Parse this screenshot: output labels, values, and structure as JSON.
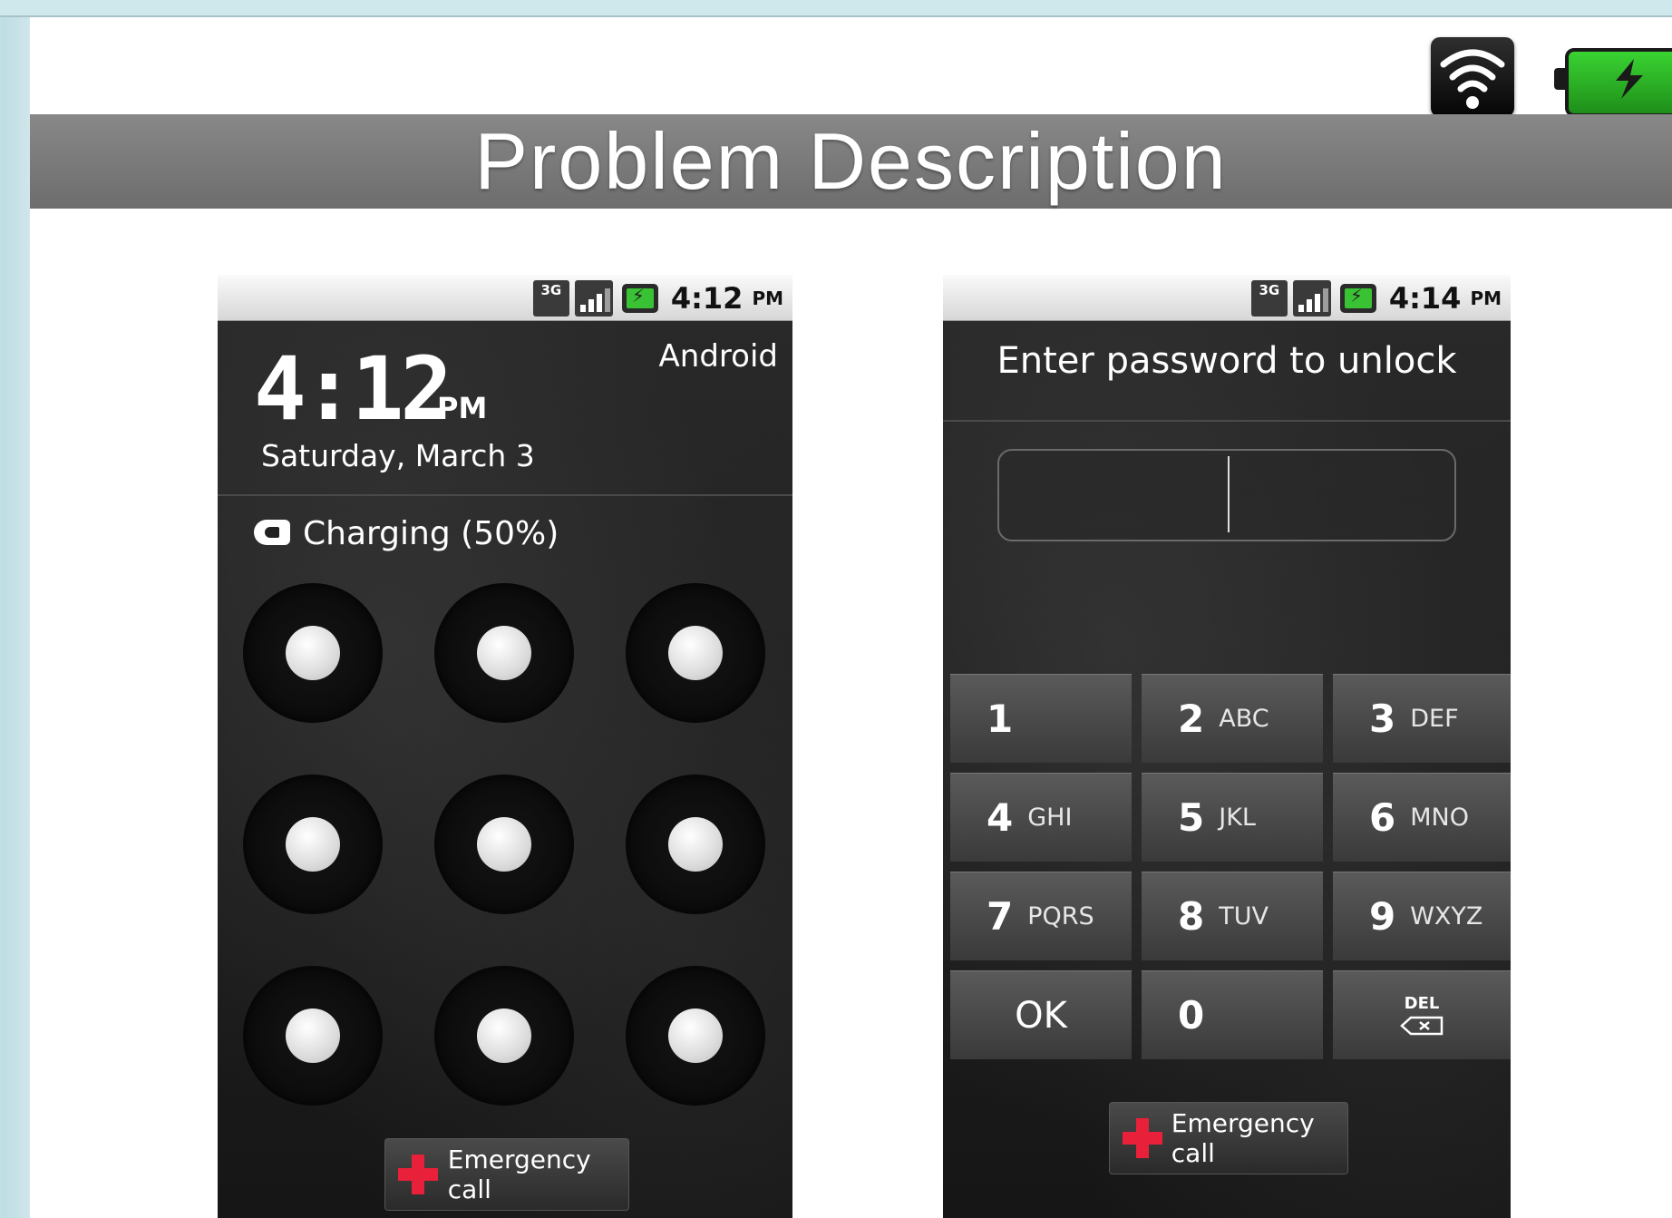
{
  "slide": {
    "title": "Problem Description",
    "icons": [
      "wifi-icon",
      "battery-charging-icon"
    ]
  },
  "lock_pattern_screen": {
    "status_bar": {
      "network": "3G",
      "icons": [
        "3g-icon",
        "signal-icon",
        "battery-icon"
      ],
      "time": "4:12",
      "ampm": "PM"
    },
    "clock": "4:12",
    "clock_ampm": "PM",
    "carrier": "Android",
    "date": "Saturday, March 3",
    "charging": "Charging (50%)",
    "emergency_call": "Emergency call"
  },
  "password_screen": {
    "status_bar": {
      "network": "3G",
      "icons": [
        "3g-icon",
        "signal-icon",
        "battery-icon"
      ],
      "time": "4:14",
      "ampm": "PM"
    },
    "prompt": "Enter password to unlock",
    "password_value": "",
    "keys": [
      {
        "digit": "1",
        "letters": ""
      },
      {
        "digit": "2",
        "letters": "ABC"
      },
      {
        "digit": "3",
        "letters": "DEF"
      },
      {
        "digit": "4",
        "letters": "GHI"
      },
      {
        "digit": "5",
        "letters": "JKL"
      },
      {
        "digit": "6",
        "letters": "MNO"
      },
      {
        "digit": "7",
        "letters": "PQRS"
      },
      {
        "digit": "8",
        "letters": "TUV"
      },
      {
        "digit": "9",
        "letters": "WXYZ"
      },
      {
        "digit": "OK",
        "letters": ""
      },
      {
        "digit": "0",
        "letters": ""
      },
      {
        "digit": "DEL",
        "letters": ""
      }
    ],
    "emergency_call": "Emergency call"
  },
  "colors": {
    "title_bar": "#7a7a7a",
    "emergency_cross": "#e8203a",
    "battery_green": "#39c334"
  }
}
